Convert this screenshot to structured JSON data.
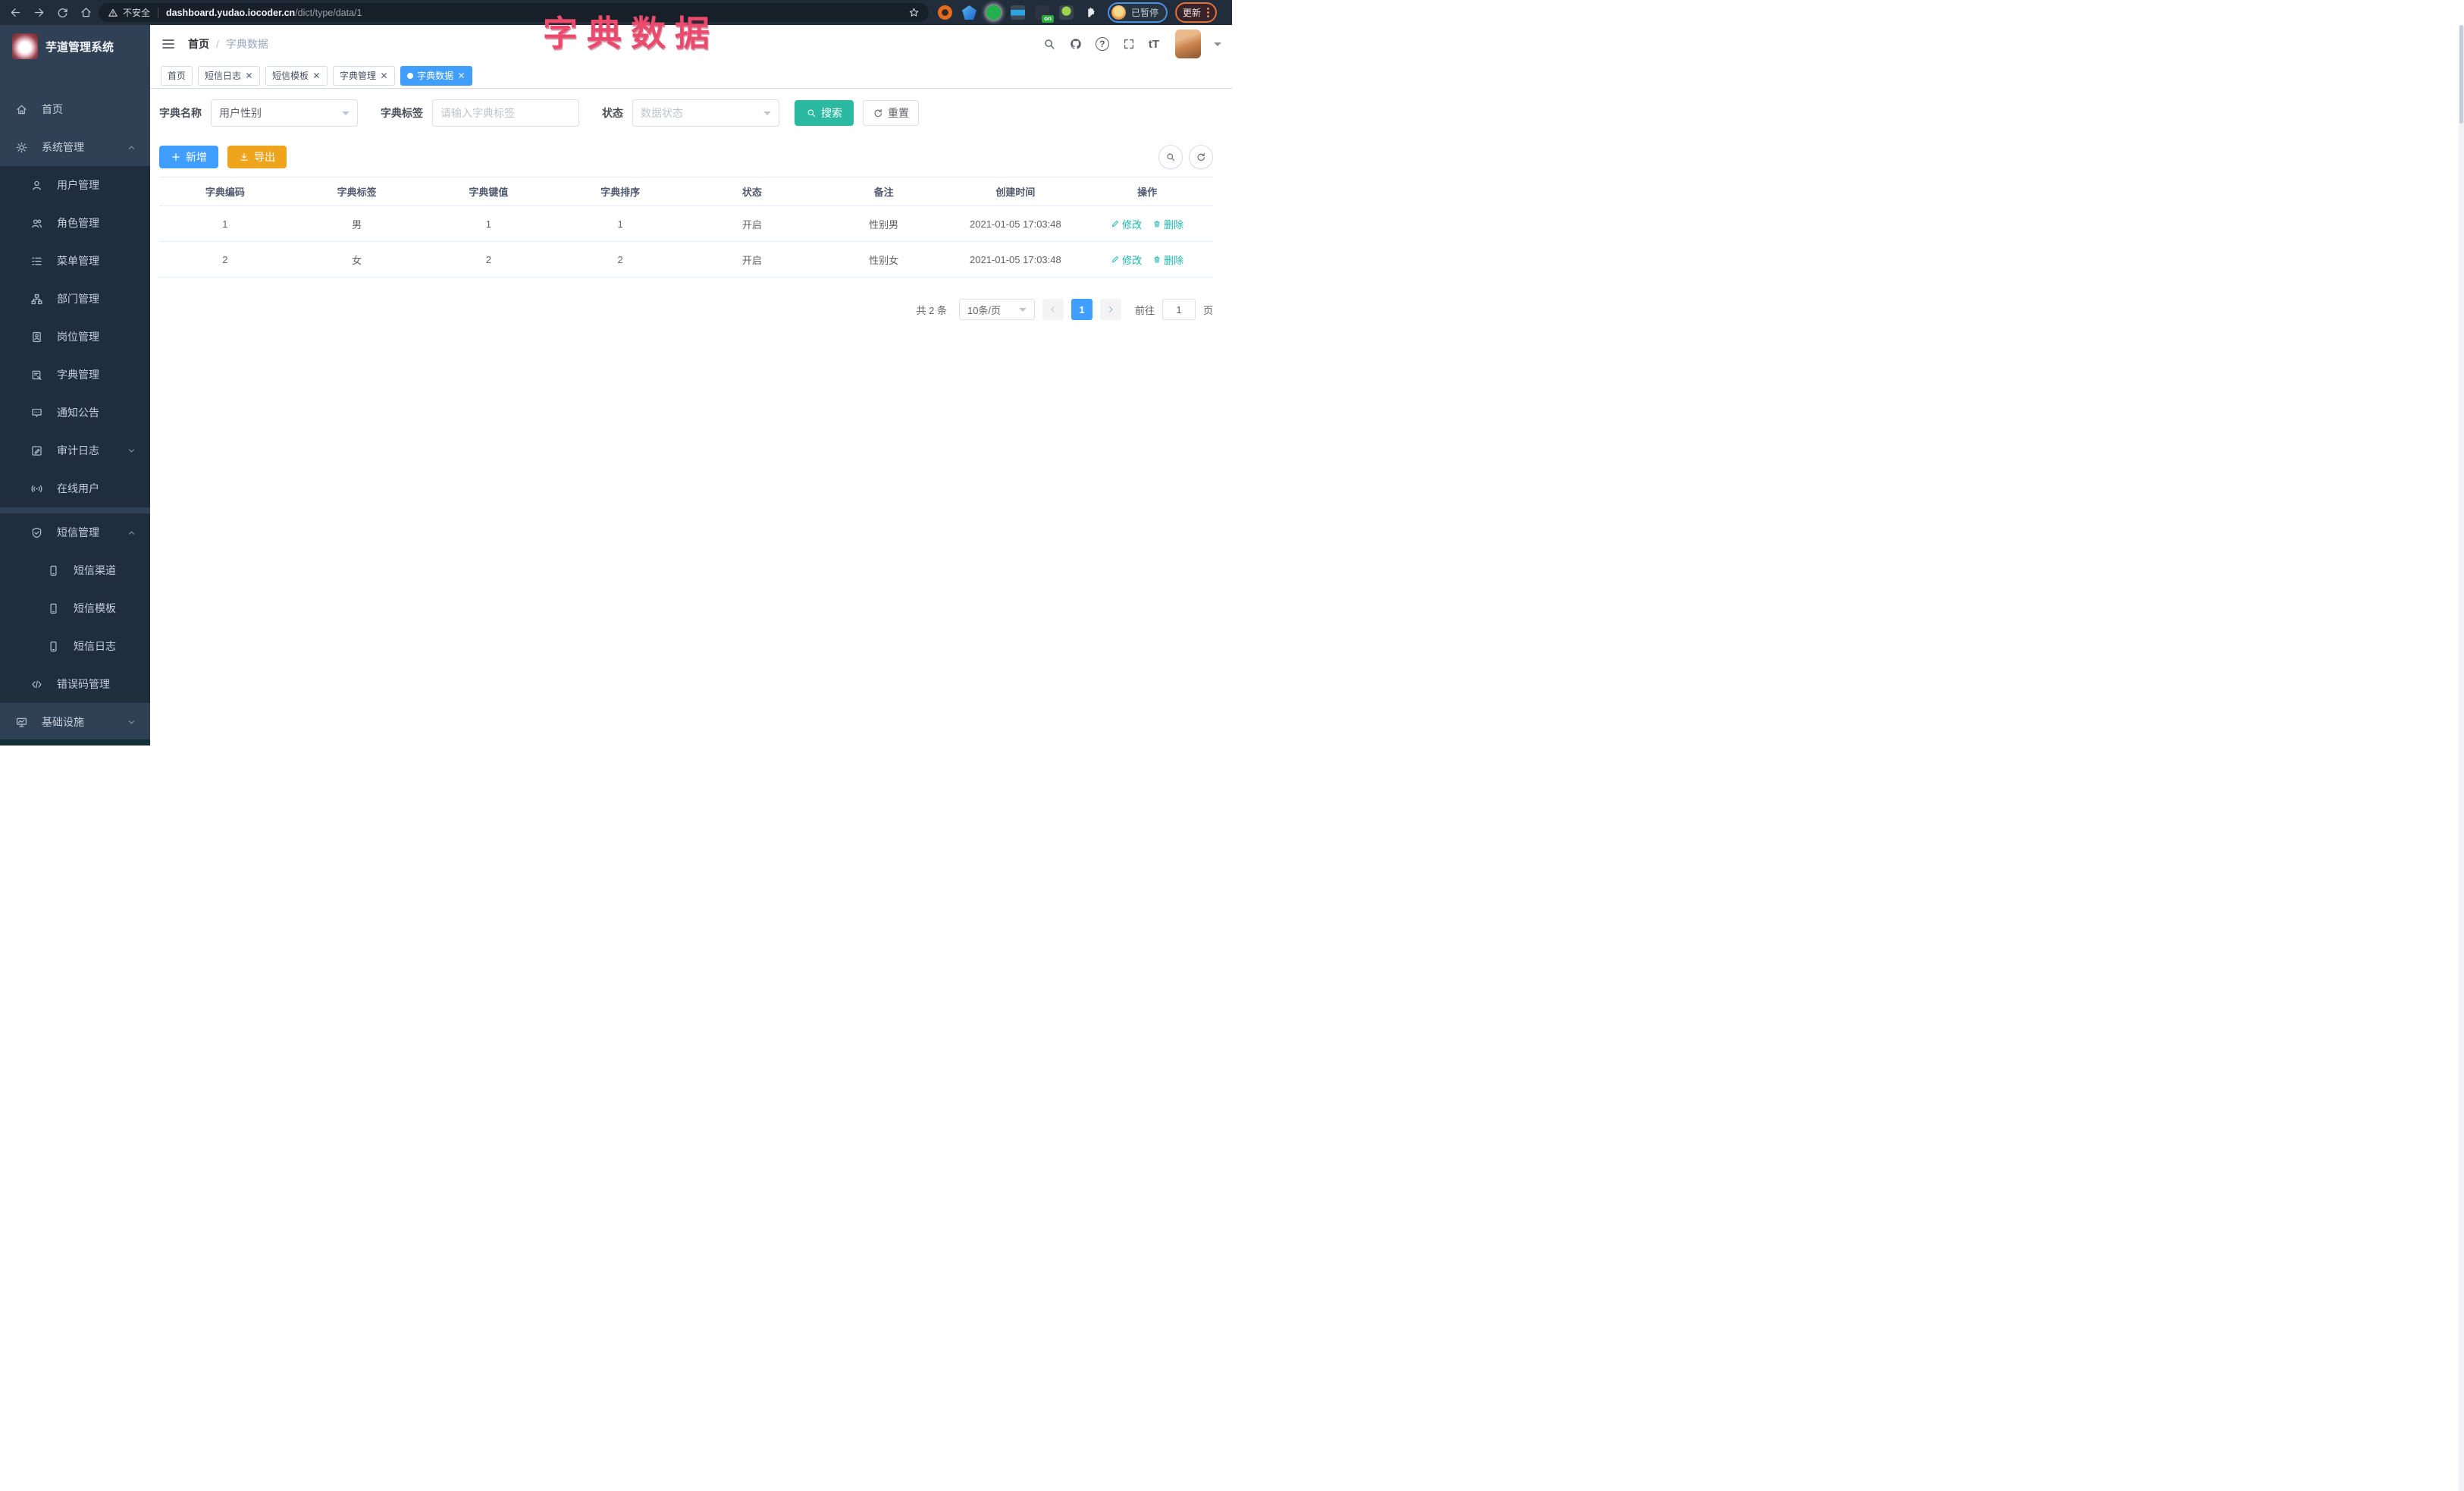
{
  "browser": {
    "security_label": "不安全",
    "url_domain": "dashboard.yudao.iocoder.cn",
    "url_path": "/dict/type/data/1",
    "extension_on_badge": "on",
    "profile_status": "已暂停",
    "update_label": "更新"
  },
  "overlay_title": "字典数据",
  "sidebar": {
    "logo_title": "芋道管理系统",
    "items": [
      {
        "label": "首页",
        "icon": "home",
        "level": 1
      },
      {
        "label": "系统管理",
        "icon": "gear",
        "level": 1,
        "arrow": "up"
      },
      {
        "label": "用户管理",
        "icon": "user",
        "level": 2
      },
      {
        "label": "角色管理",
        "icon": "users",
        "level": 2
      },
      {
        "label": "菜单管理",
        "icon": "list",
        "level": 2
      },
      {
        "label": "部门管理",
        "icon": "tree",
        "level": 2
      },
      {
        "label": "岗位管理",
        "icon": "badge",
        "level": 2
      },
      {
        "label": "字典管理",
        "icon": "book",
        "level": 2
      },
      {
        "label": "通知公告",
        "icon": "comment",
        "level": 2
      },
      {
        "label": "审计日志",
        "icon": "log",
        "level": 2,
        "arrow": "down"
      },
      {
        "label": "在线用户",
        "icon": "online",
        "level": 2
      },
      {
        "label": "短信管理",
        "icon": "shield",
        "level": 2,
        "arrow": "up",
        "gap": true
      },
      {
        "label": "短信渠道",
        "icon": "phone",
        "level": 3
      },
      {
        "label": "短信模板",
        "icon": "phone",
        "level": 3
      },
      {
        "label": "短信日志",
        "icon": "phone",
        "level": 3
      },
      {
        "label": "错误码管理",
        "icon": "code",
        "level": 2
      },
      {
        "label": "基础设施",
        "icon": "monitor",
        "level": 1,
        "arrow": "down"
      }
    ]
  },
  "header": {
    "breadcrumb_home": "首页",
    "breadcrumb_sep": "/",
    "breadcrumb_current": "字典数据",
    "font_size_glyph": "tT",
    "help_glyph": "?"
  },
  "tags": [
    {
      "label": "首页",
      "active": false,
      "closable": false
    },
    {
      "label": "短信日志",
      "active": false,
      "closable": true
    },
    {
      "label": "短信模板",
      "active": false,
      "closable": true
    },
    {
      "label": "字典管理",
      "active": false,
      "closable": true
    },
    {
      "label": "字典数据",
      "active": true,
      "closable": true
    }
  ],
  "filters": {
    "name_label": "字典名称",
    "name_value": "用户性别",
    "tag_label": "字典标签",
    "tag_placeholder": "请输入字典标签",
    "status_label": "状态",
    "status_placeholder": "数据状态",
    "search_label": "搜索",
    "reset_label": "重置"
  },
  "toolbar": {
    "add_label": "新增",
    "export_label": "导出"
  },
  "table": {
    "headers": [
      "字典编码",
      "字典标签",
      "字典键值",
      "字典排序",
      "状态",
      "备注",
      "创建时间",
      "操作"
    ],
    "row_keys": [
      "code",
      "label",
      "value",
      "sort",
      "status",
      "remark",
      "created"
    ],
    "rows": [
      {
        "code": "1",
        "label": "男",
        "value": "1",
        "sort": "1",
        "status": "开启",
        "remark": "性别男",
        "created": "2021-01-05 17:03:48"
      },
      {
        "code": "2",
        "label": "女",
        "value": "2",
        "sort": "2",
        "status": "开启",
        "remark": "性别女",
        "created": "2021-01-05 17:03:48"
      }
    ],
    "actions": {
      "edit": "修改",
      "delete": "删除"
    }
  },
  "pagination": {
    "total_label": "共 2 条",
    "page_size": "10条/页",
    "current_page": "1",
    "goto_label": "前往",
    "goto_value": "1",
    "page_unit": "页"
  },
  "colors": {
    "primary": "#409EFF",
    "accent_teal": "#2CB9A2",
    "warning": "#EFA41D",
    "sidebar_bg": "#304156",
    "sidebar_submenu_bg": "#1F2D3D",
    "title_pink": "#EA4A6B"
  }
}
